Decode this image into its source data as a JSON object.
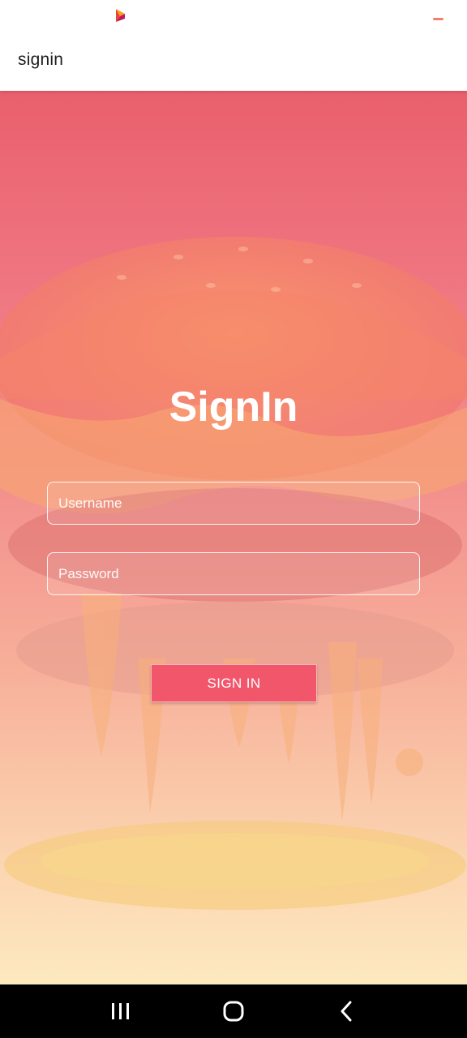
{
  "status_bar": {
    "logo_icon": "orange-purple-chevron-logo",
    "indicator_color": "#f0826b"
  },
  "app_bar": {
    "title": "signin"
  },
  "form": {
    "heading": "SignIn",
    "username_placeholder": "Username",
    "username_value": "",
    "password_placeholder": "Password",
    "password_value": "",
    "submit_label": "SIGN IN"
  },
  "background": {
    "image": "melting-burger-illustration",
    "gradient_top": "#e9606c",
    "gradient_bottom": "#fde9bf"
  },
  "colors": {
    "button": "#f2566b",
    "heading": "#ffffff"
  },
  "nav_bar": {
    "recents_icon": "recents-icon",
    "home_icon": "home-icon",
    "back_icon": "back-icon"
  }
}
